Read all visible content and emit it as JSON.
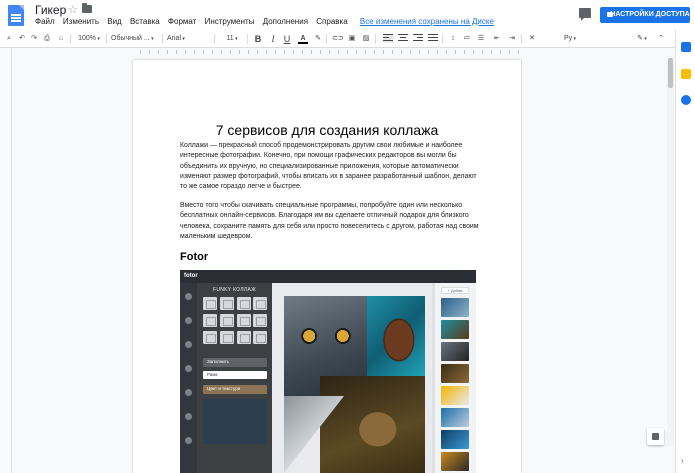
{
  "header": {
    "doc_title": "Гикер",
    "menu": [
      "Файл",
      "Изменить",
      "Вид",
      "Вставка",
      "Формат",
      "Инструменты",
      "Дополнения",
      "Справка"
    ],
    "saved_status": "Все изменения сохранены на Диске",
    "share_label": "НАСТРОЙКИ ДОСТУПА"
  },
  "toolbar": {
    "zoom": "100%",
    "style": "Обычный ...",
    "font": "Arial",
    "size": "11",
    "bold": "B",
    "italic": "I",
    "underline": "U",
    "text_color": "A",
    "input_tools": "Ру"
  },
  "document": {
    "title": "7 сервисов для создания коллажа",
    "paragraph1": "Коллажи — прекрасный способ продемонстрировать другим свои любимые и наиболее интересные фотографии. Конечно, при помощи графических редакторов вы могли бы объединить их вручную, но специализированные приложения, которые автоматически изменяют размер фотографий, чтобы вписать их в заранее разработанный шаблон, делают то же самое гораздо легче и быстрее.",
    "paragraph2": "Вместо того чтобы скачивать специальные программы, попробуйте один или несколько бесплатных онлайн-сервисов. Благодаря им вы сделаете отличный подарок для близкого человека, сохраните память для себя или просто повеселитесь с другом, работая над своим маленьким шедевром.",
    "heading": "Fotor"
  },
  "screenshot": {
    "logo": "fotor",
    "panel_title": "FUNKY КОЛЛАЖ",
    "bar1_label": "Заполнить",
    "bar2_label": "Рамк",
    "bar3_label": "Цвет и текстура",
    "add_button": "+ Добав"
  },
  "colors": {
    "accent": "#1a73e8",
    "doc_icon": "#4285f4"
  }
}
